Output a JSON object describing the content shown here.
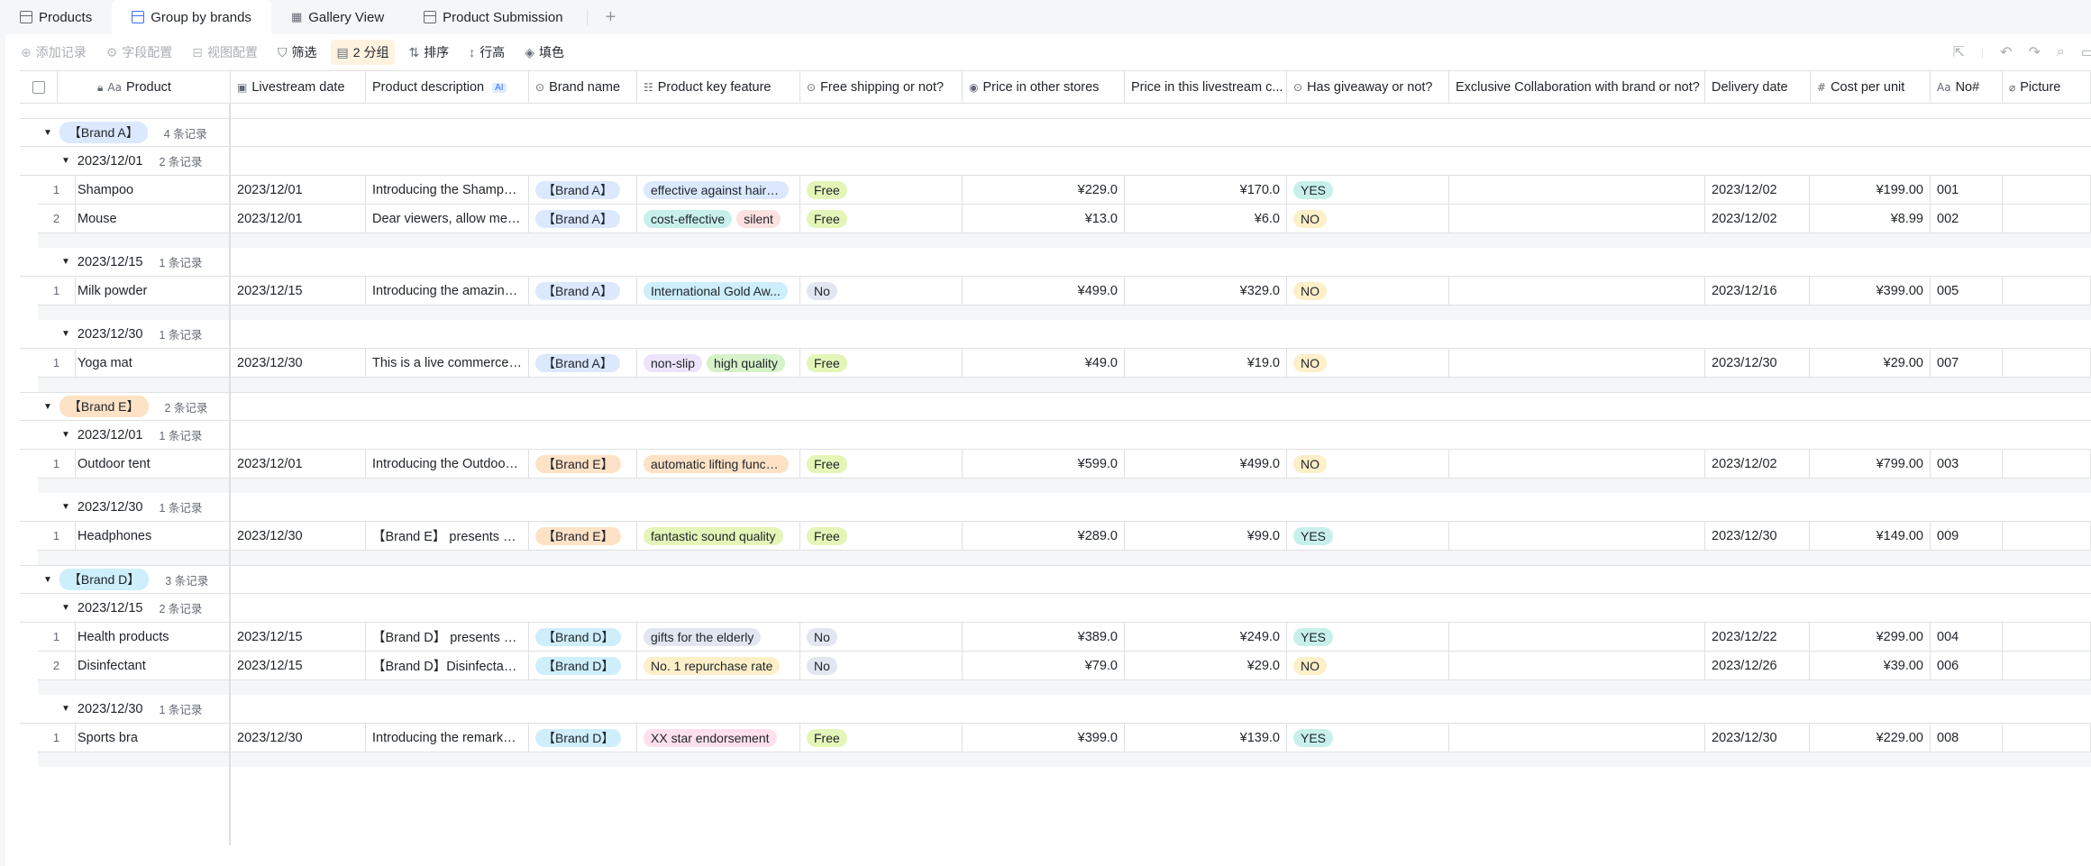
{
  "tabs": [
    {
      "label": "Products",
      "active": false
    },
    {
      "label": "Group by brands",
      "active": true
    },
    {
      "label": "Gallery View",
      "active": false
    },
    {
      "label": "Product Submission",
      "active": false
    }
  ],
  "toolbar": {
    "add_record": "添加记录",
    "field_config": "字段配置",
    "view_config": "视图配置",
    "filter": "筛选",
    "group": "2 分组",
    "sort": "排序",
    "row_height": "行高",
    "fill_color": "填色"
  },
  "columns": {
    "product": "Product",
    "livestream_date": "Livestream date",
    "product_description": "Product description",
    "ai_badge": "AI",
    "brand_name": "Brand name",
    "key_feature": "Product key feature",
    "free_shipping": "Free shipping or not?",
    "price_other": "Price in other stores",
    "price_live": "Price in this livestream c...",
    "giveaway": "Has giveaway or not?",
    "exclusive": "Exclusive Collaboration with brand or not?",
    "delivery": "Delivery date",
    "cost": "Cost per unit",
    "no": "No#",
    "picture": "Picture"
  },
  "colors": {
    "brand_a": "#dbe8fd",
    "brand_e": "#fde2c6",
    "brand_d": "#cdeefa",
    "free": "#e4f5b8",
    "no": "#e1e6f0",
    "yes": "#c8f0ea",
    "giveaway_no": "#fdefc8"
  },
  "groups": [
    {
      "brand": "【Brand A】",
      "count": "4 条记录",
      "tag_color": "#dbe8fd",
      "subgroups": [
        {
          "date": "2023/12/01",
          "count": "2 条记录",
          "rows": [
            {
              "n": "1",
              "product": "Shampoo",
              "date": "2023/12/01",
              "desc": "Introducing the Shampoo that is sweeping the market",
              "brand": "【Brand A】",
              "features": [
                {
                  "t": "effective against hair l...",
                  "c": "#dbe8fd"
                }
              ],
              "ship": "Free",
              "ship_c": "#e4f5b8",
              "p_other": "¥229.0",
              "p_live": "¥170.0",
              "give": "YES",
              "give_c": "#c8f0ea",
              "exclusive": "",
              "delivery": "2023/12/02",
              "cost": "¥199.00",
              "no": "001"
            },
            {
              "n": "2",
              "product": "Mouse",
              "date": "2023/12/01",
              "desc": "Dear viewers, allow me to introduce",
              "brand": "【Brand A】",
              "features": [
                {
                  "t": "cost-effective",
                  "c": "#c8f0ea"
                },
                {
                  "t": "silent",
                  "c": "#fde0e0"
                }
              ],
              "ship": "Free",
              "ship_c": "#e4f5b8",
              "p_other": "¥13.0",
              "p_live": "¥6.0",
              "give": "NO",
              "give_c": "#fdefc8",
              "exclusive": "",
              "delivery": "2023/12/02",
              "cost": "¥8.99",
              "no": "002"
            }
          ]
        },
        {
          "date": "2023/12/15",
          "count": "1 条记录",
          "rows": [
            {
              "n": "1",
              "product": "Milk powder",
              "date": "2023/12/15",
              "desc": "Introducing the amazing milk powder",
              "brand": "【Brand A】",
              "features": [
                {
                  "t": "International Gold Aw...",
                  "c": "#cdeefa"
                }
              ],
              "ship": "No",
              "ship_c": "#e1e6f0",
              "p_other": "¥499.0",
              "p_live": "¥329.0",
              "give": "NO",
              "give_c": "#fdefc8",
              "exclusive": "",
              "delivery": "2023/12/16",
              "cost": "¥399.00",
              "no": "005"
            }
          ]
        },
        {
          "date": "2023/12/30",
          "count": "1 条记录",
          "rows": [
            {
              "n": "1",
              "product": "Yoga mat",
              "date": "2023/12/30",
              "desc": "This is a live commerce stream",
              "brand": "【Brand A】",
              "features": [
                {
                  "t": "non-slip",
                  "c": "#ece4fb"
                },
                {
                  "t": "high quality",
                  "c": "#d6f2c8"
                }
              ],
              "ship": "Free",
              "ship_c": "#e4f5b8",
              "p_other": "¥49.0",
              "p_live": "¥19.0",
              "give": "NO",
              "give_c": "#fdefc8",
              "exclusive": "",
              "delivery": "2023/12/30",
              "cost": "¥29.00",
              "no": "007"
            }
          ]
        }
      ]
    },
    {
      "brand": "【Brand E】",
      "count": "2 条记录",
      "tag_color": "#fde2c6",
      "subgroups": [
        {
          "date": "2023/12/01",
          "count": "1 条记录",
          "rows": [
            {
              "n": "1",
              "product": "Outdoor tent",
              "date": "2023/12/01",
              "desc": "Introducing the Outdoor tent",
              "brand": "【Brand E】",
              "features": [
                {
                  "t": "automatic lifting functi...",
                  "c": "#fde2c6"
                }
              ],
              "ship": "Free",
              "ship_c": "#e4f5b8",
              "p_other": "¥599.0",
              "p_live": "¥499.0",
              "give": "NO",
              "give_c": "#fdefc8",
              "exclusive": "",
              "delivery": "2023/12/02",
              "cost": "¥799.00",
              "no": "003"
            }
          ]
        },
        {
          "date": "2023/12/30",
          "count": "1 条记录",
          "rows": [
            {
              "n": "1",
              "product": "Headphones",
              "date": "2023/12/30",
              "desc": "【Brand E】 presents our headphones",
              "brand": "【Brand E】",
              "features": [
                {
                  "t": "fantastic sound quality",
                  "c": "#e4f5b8"
                }
              ],
              "ship": "Free",
              "ship_c": "#e4f5b8",
              "p_other": "¥289.0",
              "p_live": "¥99.0",
              "give": "YES",
              "give_c": "#c8f0ea",
              "exclusive": "",
              "delivery": "2023/12/30",
              "cost": "¥149.00",
              "no": "009"
            }
          ]
        }
      ]
    },
    {
      "brand": "【Brand D】",
      "count": "3 条记录",
      "tag_color": "#cdeefa",
      "subgroups": [
        {
          "date": "2023/12/15",
          "count": "2 条记录",
          "rows": [
            {
              "n": "1",
              "product": "Health products",
              "date": "2023/12/15",
              "desc": "【Brand D】 presents our health products",
              "brand": "【Brand D】",
              "features": [
                {
                  "t": "gifts for the elderly",
                  "c": "#e1e6f0"
                }
              ],
              "ship": "No",
              "ship_c": "#e1e6f0",
              "p_other": "¥389.0",
              "p_live": "¥249.0",
              "give": "YES",
              "give_c": "#c8f0ea",
              "exclusive": "",
              "delivery": "2023/12/22",
              "cost": "¥299.00",
              "no": "004"
            },
            {
              "n": "2",
              "product": "Disinfectant",
              "date": "2023/12/15",
              "desc": "【Brand D】Disinfectant is here",
              "brand": "【Brand D】",
              "features": [
                {
                  "t": "No. 1 repurchase rate",
                  "c": "#fdefc8"
                }
              ],
              "ship": "No",
              "ship_c": "#e1e6f0",
              "p_other": "¥79.0",
              "p_live": "¥29.0",
              "give": "NO",
              "give_c": "#fdefc8",
              "exclusive": "",
              "delivery": "2023/12/26",
              "cost": "¥39.00",
              "no": "006"
            }
          ]
        },
        {
          "date": "2023/12/30",
          "count": "1 条记录",
          "rows": [
            {
              "n": "1",
              "product": "Sports bra",
              "date": "2023/12/30",
              "desc": "Introducing the remarkable sports bra",
              "brand": "【Brand D】",
              "features": [
                {
                  "t": "XX star endorsement",
                  "c": "#fde0ec"
                }
              ],
              "ship": "Free",
              "ship_c": "#e4f5b8",
              "p_other": "¥399.0",
              "p_live": "¥139.0",
              "give": "YES",
              "give_c": "#c8f0ea",
              "exclusive": "",
              "delivery": "2023/12/30",
              "cost": "¥229.00",
              "no": "008"
            }
          ]
        }
      ]
    }
  ]
}
